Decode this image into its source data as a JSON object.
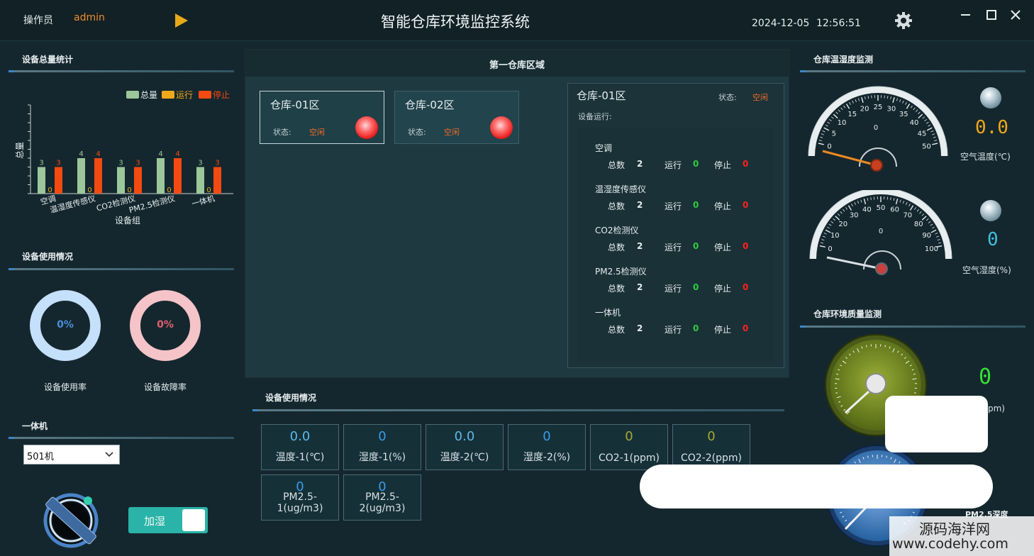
{
  "header": {
    "operator_label": "操作员",
    "operator_name": "admin",
    "title": "智能仓库环境监控系统",
    "date": "2024-12-05",
    "time": "12:56:51"
  },
  "left": {
    "stats_title": "设备总量统计",
    "legend": [
      "总量",
      "运行",
      "停止"
    ],
    "usage_title": "设备使用情况",
    "donut1": {
      "value": "0%",
      "label": "设备使用率"
    },
    "donut2": {
      "value": "0%",
      "label": "设备故障率"
    },
    "aio_title": "一体机",
    "aio_select": "501机",
    "humidify_label": "加湿"
  },
  "center": {
    "zone_title": "第一仓库区域",
    "zones": [
      {
        "name": "仓库-01区",
        "status_label": "状态:",
        "status": "空闲"
      },
      {
        "name": "仓库-02区",
        "status_label": "状态:",
        "status": "空闲"
      }
    ],
    "detail": {
      "name": "仓库-01区",
      "status_label": "状态:",
      "status": "空闲",
      "run_label": "设备运行:",
      "total_label": "总数",
      "run_text": "运行",
      "stop_text": "停止",
      "devices": [
        {
          "name": "空调",
          "total": "2",
          "run": "0",
          "stop": "0"
        },
        {
          "name": "温湿度传感仪",
          "total": "2",
          "run": "0",
          "stop": "0"
        },
        {
          "name": "CO2检测仪",
          "total": "2",
          "run": "0",
          "stop": "0"
        },
        {
          "name": "PM2.5检测仪",
          "total": "2",
          "run": "0",
          "stop": "0"
        },
        {
          "name": "一体机",
          "total": "2",
          "run": "0",
          "stop": "0"
        }
      ]
    },
    "usage_title": "设备使用情况",
    "readings": [
      {
        "value": "0.0",
        "label": "温度-1(℃)"
      },
      {
        "value": "0",
        "label": "湿度-1(%)"
      },
      {
        "value": "0.0",
        "label": "温度-2(℃)"
      },
      {
        "value": "0",
        "label": "湿度-2(%)"
      },
      {
        "value": "0",
        "label": "CO2-1(ppm)"
      },
      {
        "value": "0",
        "label": "CO2-2(ppm)"
      },
      {
        "value": "0",
        "label": "PM2.5-1(ug/m3)"
      },
      {
        "value": "0",
        "label": "PM2.5-2(ug/m3)"
      }
    ]
  },
  "right": {
    "th_title": "仓库温湿度监测",
    "temp_gauge": {
      "ticks": [
        "0",
        "5",
        "10",
        "15",
        "20",
        "25",
        "30",
        "35",
        "40",
        "45",
        "50"
      ],
      "center": "0",
      "value": 0
    },
    "temp_value": "0.0",
    "temp_label": "空气温度(℃)",
    "hum_gauge": {
      "ticks": [
        "0",
        "10",
        "20",
        "30",
        "40",
        "50",
        "60",
        "70",
        "80",
        "90",
        "100"
      ],
      "center": "0",
      "value": 0
    },
    "hum_value": "0",
    "hum_label": "空气湿度(%)",
    "env_title": "仓库环境质量监测",
    "co2_value": "0",
    "co2_unit_partial": "pm)",
    "pm_label": "PM2.5深度"
  },
  "watermark": {
    "line1": "源码海洋网",
    "line2": "www.codehy.com"
  },
  "chart_data": {
    "type": "bar",
    "title": "",
    "xlabel": "设备组",
    "ylabel": "总量",
    "categories": [
      "空调",
      "温湿度传感仪",
      "CO2检测仪",
      "PM2.5检测仪",
      "一体机"
    ],
    "series": [
      {
        "name": "总量",
        "values": [
          3,
          4,
          3,
          4,
          3
        ]
      },
      {
        "name": "运行",
        "values": [
          0,
          0,
          0,
          0,
          0
        ]
      },
      {
        "name": "停止",
        "values": [
          3,
          4,
          3,
          4,
          3
        ]
      }
    ],
    "ylim": [
      0,
      10
    ],
    "legend": "top-right",
    "colors": {
      "总量": "#9cc79a",
      "运行": "#f0a818",
      "停止": "#f24a10"
    }
  },
  "colors": {
    "accent": "#3d86c4",
    "status_orange": "#f06a2a",
    "run_green": "#2ecc40",
    "stop_red": "#ff2020",
    "temp_led": "#f0a818",
    "hum_led": "#3fc0e0",
    "co2_led": "#34e034"
  },
  "icons": {
    "play": "play-icon",
    "settings": "gear-icon"
  }
}
